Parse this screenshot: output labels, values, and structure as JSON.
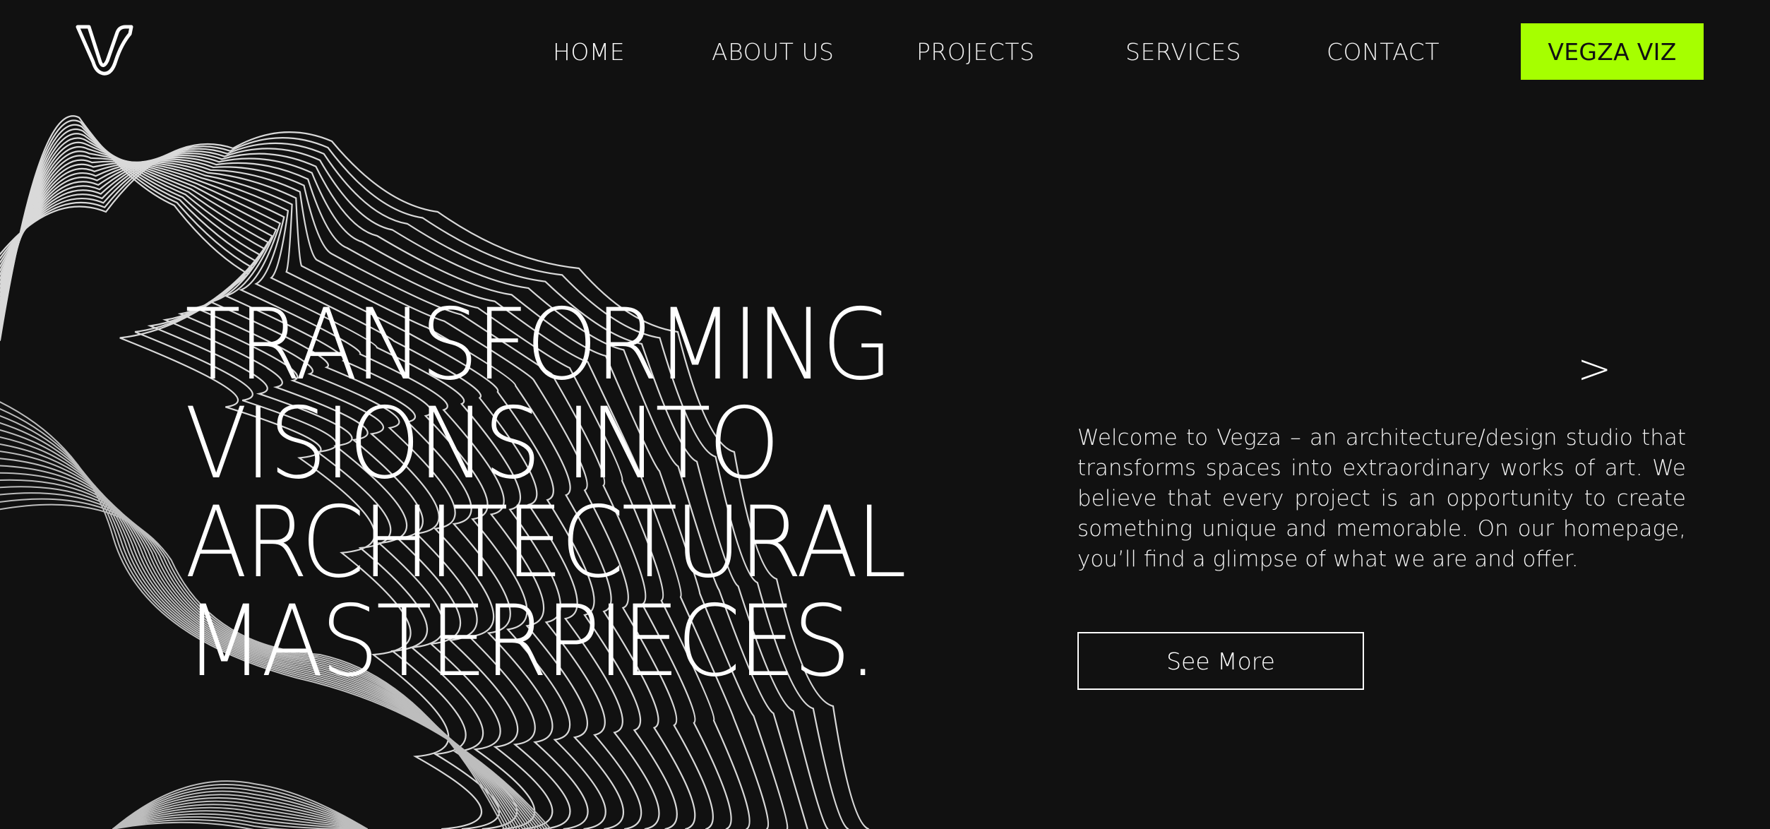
{
  "nav": {
    "items": [
      {
        "label": "HOME",
        "active": true
      },
      {
        "label": "ABOUT US",
        "active": false
      },
      {
        "label": "PROJECTS",
        "active": false
      },
      {
        "label": "SERVICES",
        "active": false
      },
      {
        "label": "CONTACT",
        "active": false
      }
    ],
    "cta_label": "VEGZA VIZ"
  },
  "hero": {
    "headline_lines": [
      "TRANSFORMING",
      "VISIONS INTO",
      "ARCHITECTURAL",
      "MASTERPIECES."
    ],
    "next_arrow": ">",
    "intro": "Welcome to Vegza – an architecture/design studio that transforms spaces into extraordinary works of art. We believe that every project is an opportunity to create something unique and memorable. On our homepage, you’ll find a glimpse of what we are and offer.",
    "button_label": "See More"
  },
  "theme": {
    "background": "#111111",
    "accent": "#a6ff00",
    "text": "#ffffff"
  },
  "icons": {
    "logo": "vegza-v-logo-icon",
    "next": "chevron-right-icon"
  }
}
